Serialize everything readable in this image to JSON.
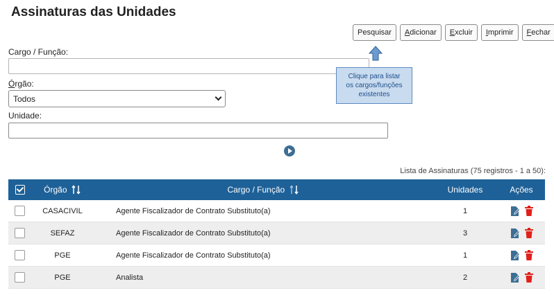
{
  "page": {
    "title": "Assinaturas das Unidades"
  },
  "toolbar": {
    "pesquisar": "Pesquisar",
    "adicionar_u": "A",
    "adicionar_rest": "dicionar",
    "excluir_u": "E",
    "excluir_rest": "xcluir",
    "imprimir_u": "I",
    "imprimir_rest": "mprimir",
    "fechar_u": "F",
    "fechar_rest": "echar"
  },
  "form": {
    "cargo_label": "Cargo / Função:",
    "cargo_value": "",
    "orgao_label_u": "Ó",
    "orgao_label_rest": "rgão:",
    "orgao_value": "Todos",
    "unidade_label": "Unidade:",
    "unidade_value": ""
  },
  "tooltip": {
    "line1": "Clique para listar",
    "line2": "os cargos/funções",
    "line3": "existentes"
  },
  "summary": "Lista de Assinaturas (75 registros - 1 a 50):",
  "table": {
    "headers": {
      "orgao": "Órgão",
      "cargo": "Cargo / Função",
      "unidades": "Unidades",
      "acoes": "Ações"
    },
    "rows": [
      {
        "orgao": "CASACIVIL",
        "cargo": "Agente Fiscalizador de Contrato Substituto(a)",
        "unidades": "1"
      },
      {
        "orgao": "SEFAZ",
        "cargo": "Agente Fiscalizador de Contrato Substituto(a)",
        "unidades": "3"
      },
      {
        "orgao": "PGE",
        "cargo": "Agente Fiscalizador de Contrato Substituto(a)",
        "unidades": "1"
      },
      {
        "orgao": "PGE",
        "cargo": "Analista",
        "unidades": "2"
      }
    ]
  },
  "colors": {
    "header_bg": "#1e6198",
    "edit_icon": "#3d6e94",
    "delete_icon": "#e0201b",
    "tooltip_bg": "#c9dbef"
  },
  "icons": {
    "sort": "sort-arrows-icon",
    "edit": "edit-icon",
    "delete": "trash-icon",
    "play": "play-icon",
    "arrow": "arrow-up-icon"
  }
}
